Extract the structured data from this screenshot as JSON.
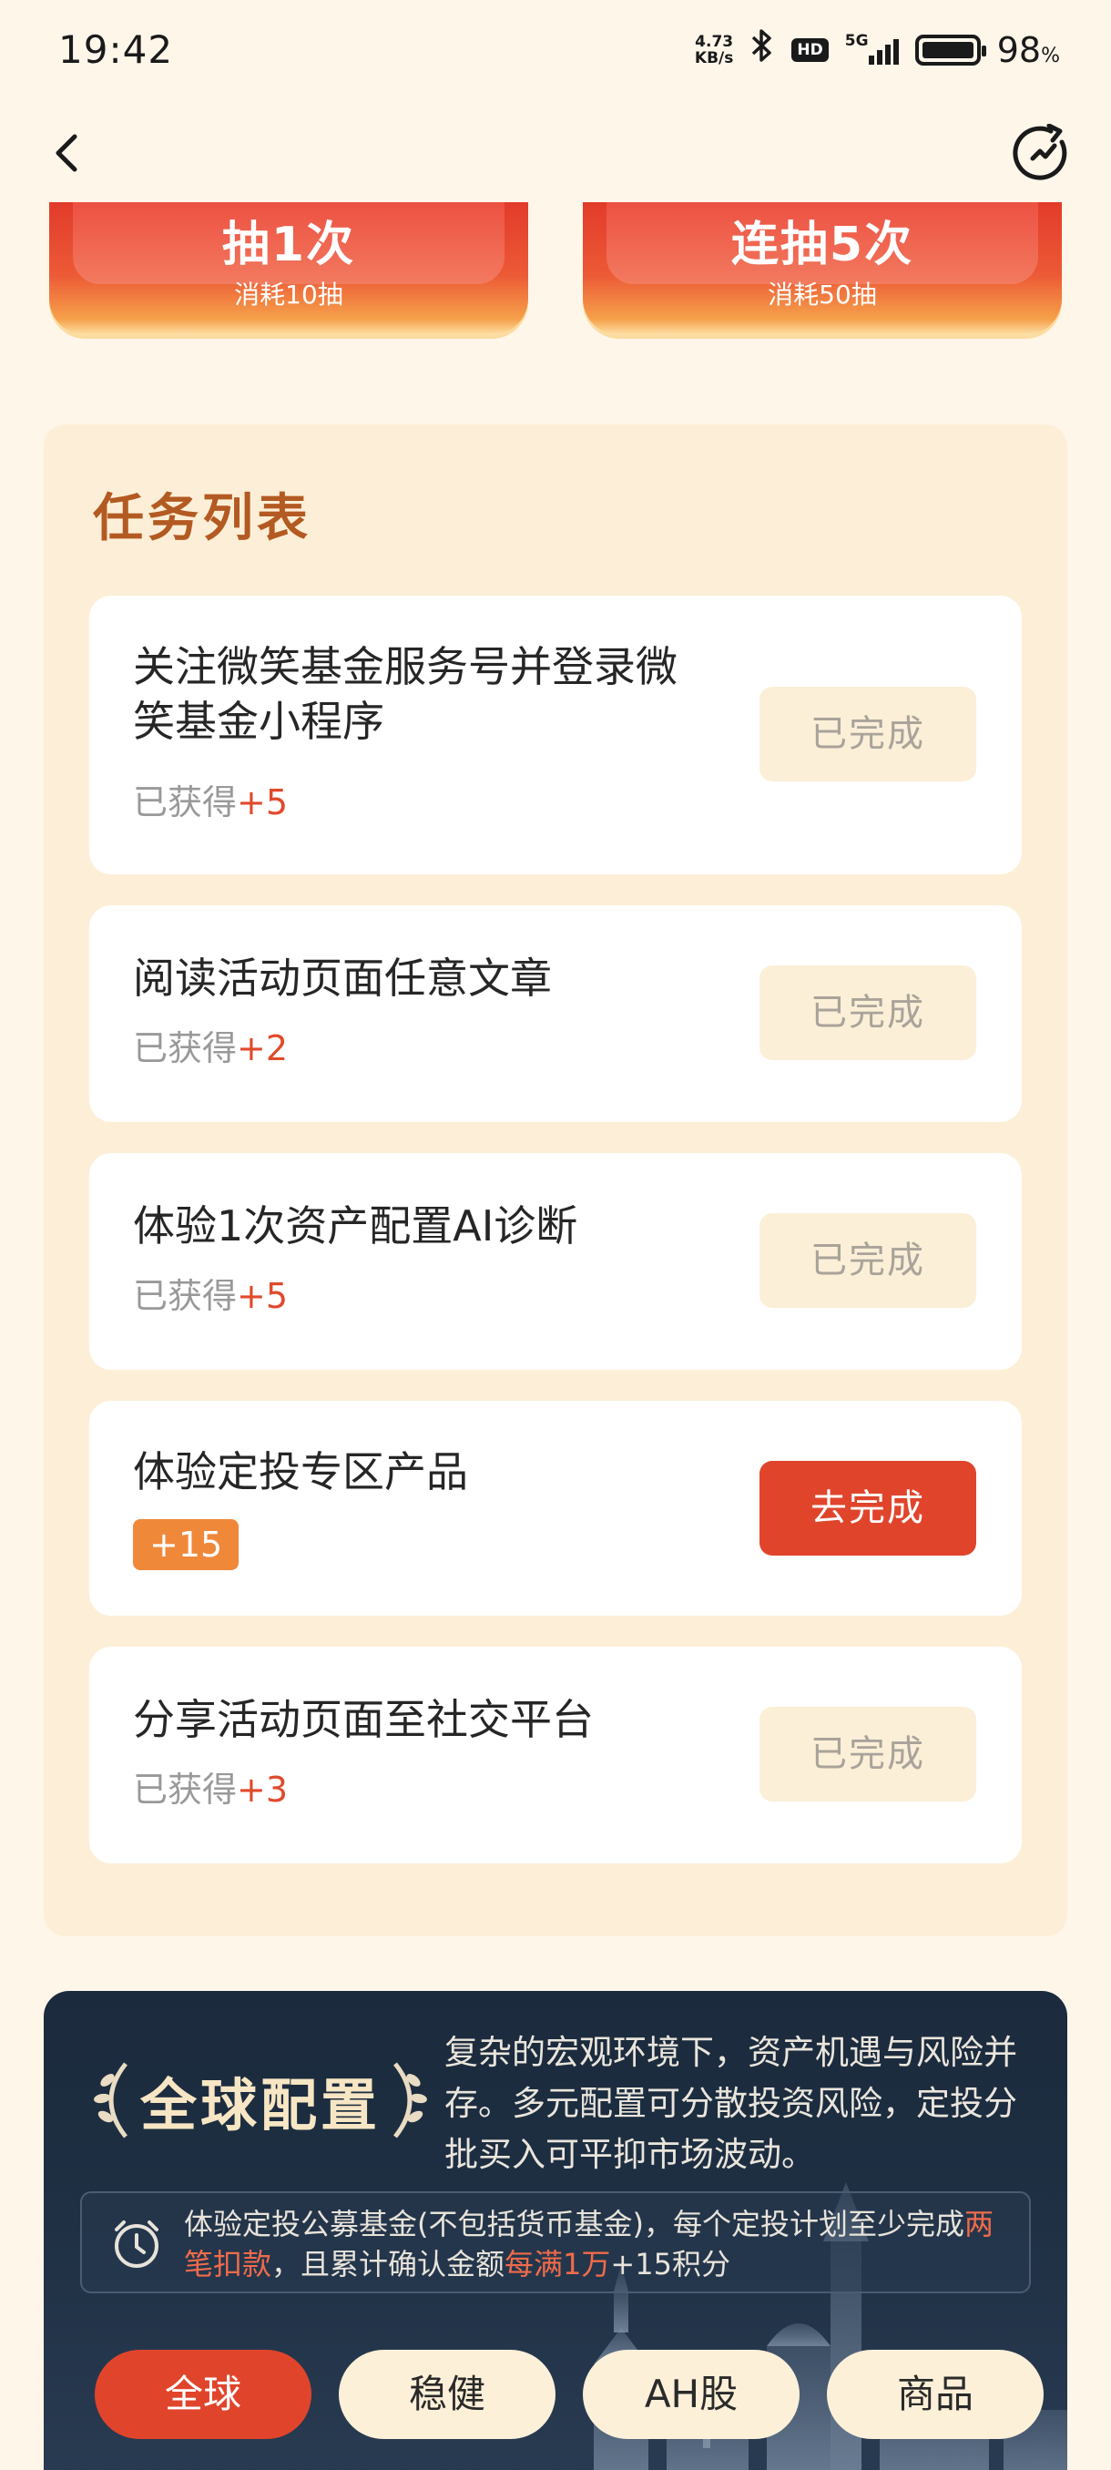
{
  "status_bar": {
    "time": "19:42",
    "net_speed_value": "4.73",
    "net_speed_unit": "KB/s",
    "hd": "HD",
    "network": "5G",
    "battery": "98",
    "battery_unit": "%"
  },
  "draw_buttons": [
    {
      "title": "抽1次",
      "sub": "消耗10抽"
    },
    {
      "title": "连抽5次",
      "sub": "消耗50抽"
    }
  ],
  "task_panel": {
    "title": "任务列表",
    "tasks": [
      {
        "title": "关注微笑基金服务号并登录微笑基金小程序",
        "reward_prefix": "已获得",
        "reward": "+5",
        "status": "已完成"
      },
      {
        "title": "阅读活动页面任意文章",
        "reward_prefix": "已获得",
        "reward": "+2",
        "status": "已完成"
      },
      {
        "title": "体验1次资产配置AI诊断",
        "reward_prefix": "已获得",
        "reward": "+5",
        "status": "已完成"
      },
      {
        "title": "体验定投专区产品",
        "reward": "+15",
        "status": "去完成"
      },
      {
        "title": "分享活动页面至社交平台",
        "reward_prefix": "已获得",
        "reward": "+3",
        "status": "已完成"
      }
    ]
  },
  "global": {
    "title": "全球配置",
    "desc": "复杂的宏观环境下，资产机遇与风险并存。多元配置可分散投资风险，定投分批买入可平抑市场波动。",
    "notice": {
      "part1": "体验定投公募基金(不包括货币基金)，每个定投计划至少完成",
      "hl1": "两笔扣款",
      "part2": "，且累计确认金额",
      "hl2": "每满1万",
      "part3": "+15积分"
    },
    "tabs": [
      "全球",
      "稳健",
      "AH股",
      "商品"
    ],
    "active_tab": "全球"
  },
  "colors": {
    "accent": "#e0452c",
    "panel_bg": "#fdefd7",
    "title_brown": "#b35a22",
    "dark_card": "#1f3044"
  }
}
